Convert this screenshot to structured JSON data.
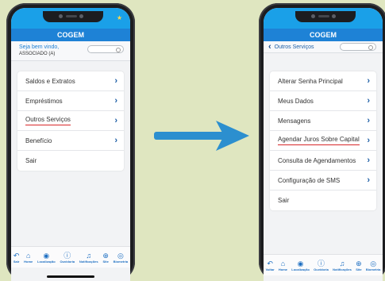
{
  "brand_color": "#1e82d6",
  "left_phone": {
    "app_title": "COGEM",
    "welcome_line1": "Seja bem vindo,",
    "welcome_line2": "ASSOCIADO (A)",
    "menu": [
      {
        "label": "Saldos e Extratos",
        "has_chevron": true
      },
      {
        "label": "Empréstimos",
        "has_chevron": true
      },
      {
        "label": "Outros Serviços",
        "has_chevron": true,
        "highlighted": true
      },
      {
        "label": "Benefício",
        "has_chevron": true
      },
      {
        "label": "Sair",
        "has_chevron": false
      }
    ],
    "tabs": [
      {
        "label": "Sair",
        "icon": "back-icon"
      },
      {
        "label": "Home",
        "icon": "home-icon"
      },
      {
        "label": "Localização",
        "icon": "location-icon"
      },
      {
        "label": "Ouvidoria",
        "icon": "info-icon"
      },
      {
        "label": "Notificações",
        "icon": "bell-icon"
      },
      {
        "label": "Site",
        "icon": "globe-icon"
      },
      {
        "label": "Biometria",
        "icon": "fingerprint-icon"
      }
    ]
  },
  "right_phone": {
    "app_title": "COGEM",
    "back_label": "Outros Serviços",
    "menu": [
      {
        "label": "Alterar Senha Principal",
        "has_chevron": true
      },
      {
        "label": "Meus Dados",
        "has_chevron": true
      },
      {
        "label": "Mensagens",
        "has_chevron": true
      },
      {
        "label": "Agendar Juros Sobre Capital",
        "has_chevron": true,
        "highlighted": true
      },
      {
        "label": "Consulta de Agendamentos",
        "has_chevron": true
      },
      {
        "label": "Configuração de SMS",
        "has_chevron": true
      },
      {
        "label": "Sair",
        "has_chevron": false
      }
    ],
    "tabs": [
      {
        "label": "Voltar",
        "icon": "back-icon"
      },
      {
        "label": "Home",
        "icon": "home-icon"
      },
      {
        "label": "Localização",
        "icon": "location-icon"
      },
      {
        "label": "Ouvidoria",
        "icon": "info-icon"
      },
      {
        "label": "Notificações",
        "icon": "bell-icon"
      },
      {
        "label": "Site",
        "icon": "globe-icon"
      },
      {
        "label": "Biometria",
        "icon": "fingerprint-icon"
      }
    ]
  },
  "arrow_icon": "arrow-right-icon",
  "arrow_color": "#2c8fcf"
}
